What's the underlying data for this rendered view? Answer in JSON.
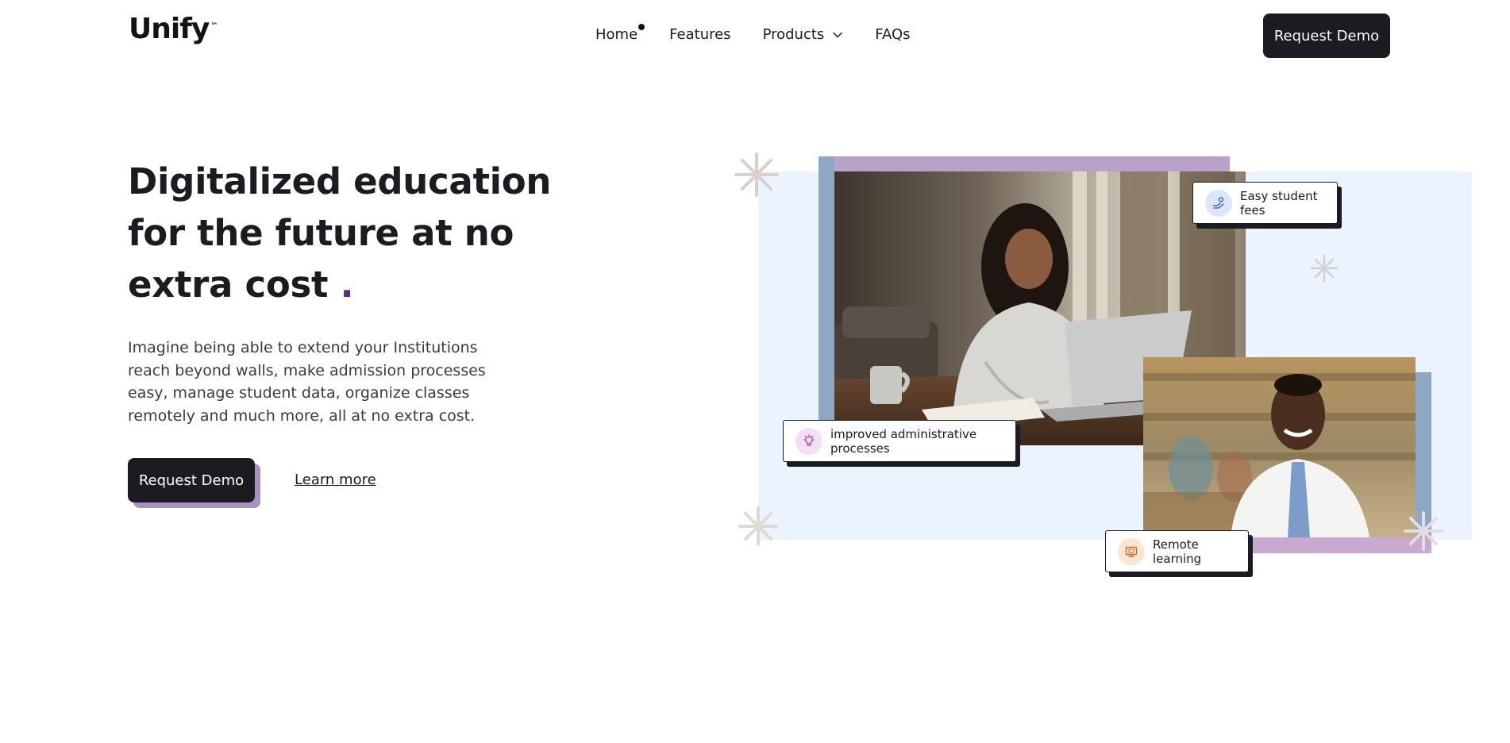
{
  "brand": {
    "name": "Unify",
    "tm": "™"
  },
  "nav": {
    "items": [
      {
        "label": "Home",
        "active": true
      },
      {
        "label": "Features"
      },
      {
        "label": "Products",
        "has_dropdown": true
      },
      {
        "label": "FAQs"
      }
    ],
    "cta_label": "Request Demo"
  },
  "hero": {
    "title_line1": "Digitalized education",
    "title_line2": "for the future at no",
    "title_line3": "extra cost",
    "title_dot": ".",
    "description": "Imagine being able to extend your Institutions reach beyond walls, make admission processes easy, manage student data, organize classes remotely and much more, all at no extra cost.",
    "primary_cta": "Request Demo",
    "secondary_cta": "Learn more"
  },
  "badges": {
    "fees": {
      "label": "Easy student fees",
      "icon": "money-hand-icon"
    },
    "admin": {
      "label": "improved administrative processes",
      "icon": "lightbulb-icon"
    },
    "remote": {
      "label": "Remote learning",
      "icon": "monitor-icon"
    }
  },
  "colors": {
    "dark": "#1b1b22",
    "accent_purple": "#5b2a8c",
    "panel_blue": "#eaf3fe",
    "frame_purple": "#b9a1c9",
    "frame_blue": "#8ea7c4"
  }
}
